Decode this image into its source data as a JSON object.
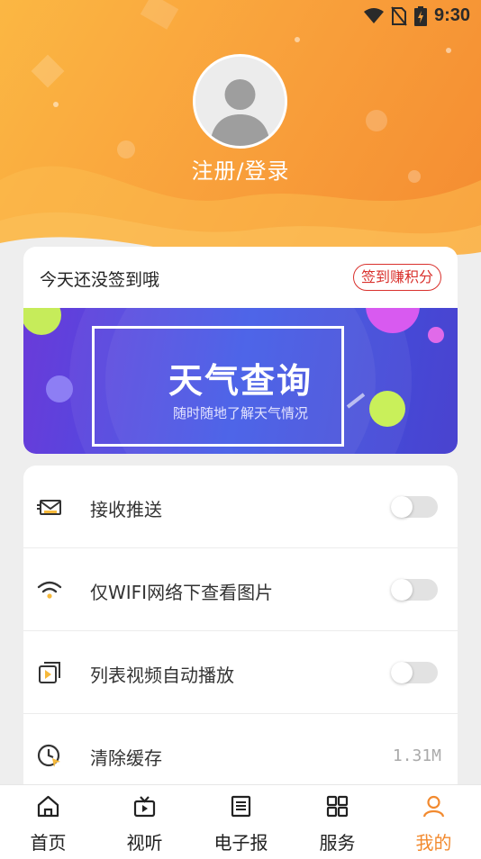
{
  "status_bar": {
    "time": "9:30",
    "icons": [
      "wifi-icon",
      "no-sim-icon",
      "battery-charging-icon"
    ]
  },
  "profile": {
    "login_text": "注册/登录",
    "avatar_icon": "default-avatar-icon"
  },
  "checkin": {
    "text": "今天还没签到哦",
    "button_label": "签到赚积分"
  },
  "banner": {
    "title": "天气查询",
    "subtitle": "随时随地了解天气情况"
  },
  "settings": {
    "items": [
      {
        "label": "接收推送",
        "icon": "envelope-icon",
        "toggle_on": false
      },
      {
        "label": "仅WIFI网络下查看图片",
        "icon": "wifi-icon",
        "toggle_on": false
      },
      {
        "label": "列表视频自动播放",
        "icon": "video-play-icon",
        "toggle_on": false
      },
      {
        "label": "清除缓存",
        "icon": "clock-icon",
        "value": "1.31M"
      }
    ]
  },
  "bottom_nav": {
    "items": [
      {
        "label": "首页",
        "icon": "home-icon"
      },
      {
        "label": "视听",
        "icon": "tv-icon"
      },
      {
        "label": "电子报",
        "icon": "newspaper-icon"
      },
      {
        "label": "服务",
        "icon": "grid-icon"
      },
      {
        "label": "我的",
        "icon": "user-icon",
        "active": true
      }
    ]
  },
  "colors": {
    "accent": "#f28a2f",
    "checkin_red": "#d9312d",
    "header_start": "#fbb743",
    "header_end": "#f48a30"
  }
}
